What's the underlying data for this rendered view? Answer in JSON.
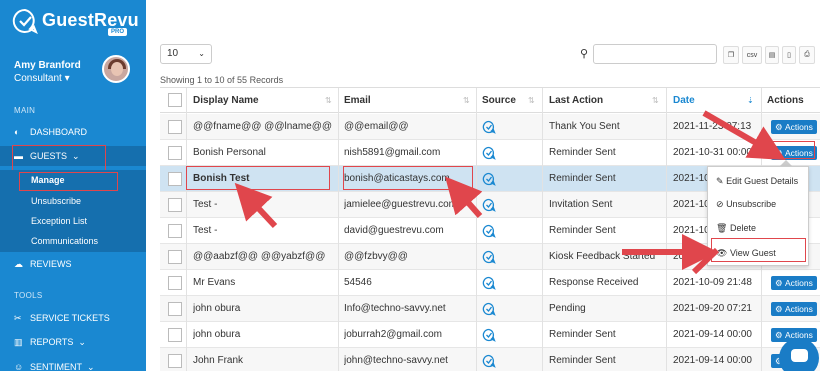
{
  "brand": {
    "name": "GuestRevu",
    "badge": "PRO"
  },
  "user": {
    "name": "Amy Branford",
    "role": "Consultant"
  },
  "sidebar": {
    "main_label": "MAIN",
    "tools_label": "TOOLS",
    "dashboard": "DASHBOARD",
    "guests": "GUESTS",
    "manage": "Manage",
    "unsubscribe": "Unsubscribe",
    "exception_list": "Exception List",
    "communications": "Communications",
    "reviews": "REVIEWS",
    "service_tickets": "SERVICE TICKETS",
    "reports": "REPORTS",
    "sentiment": "SENTIMENT"
  },
  "toolbar": {
    "page_size": "10",
    "csv": "csv"
  },
  "records_text": "Showing 1 to 10 of 55 Records",
  "table": {
    "headers": {
      "display_name": "Display Name",
      "email": "Email",
      "source": "Source",
      "last_action": "Last Action",
      "date": "Date",
      "actions": "Actions"
    },
    "action_label": "Actions",
    "rows": [
      {
        "name": "@@fname@@ @@lname@@",
        "email": "@@email@@",
        "last_action": "Thank You Sent",
        "date": "2021-11-23 07:13"
      },
      {
        "name": "Bonish Personal",
        "email": "nish5891@gmail.com",
        "last_action": "Reminder Sent",
        "date": "2021-10-31 00:00"
      },
      {
        "name": "Bonish Test",
        "email": "bonish@aticastays.com",
        "last_action": "Reminder Sent",
        "date": "2021-10"
      },
      {
        "name": "Test -",
        "email": "jamielee@guestrevu.com",
        "last_action": "Invitation Sent",
        "date": "2021-10"
      },
      {
        "name": "Test -",
        "email": "david@guestrevu.com",
        "last_action": "Reminder Sent",
        "date": "2021-10"
      },
      {
        "name": "@@aabzf@@ @@yabzf@@",
        "email": "@@fzbvy@@",
        "last_action": "Kiosk Feedback Started",
        "date": "2021-10"
      },
      {
        "name": "Mr Evans",
        "email": "54546",
        "last_action": "Response Received",
        "date": "2021-10-09 21:48"
      },
      {
        "name": "john obura",
        "email": "Info@techno-savvy.net",
        "last_action": "Pending",
        "date": "2021-09-20 07:21"
      },
      {
        "name": "john obura",
        "email": "joburrah2@gmail.com",
        "last_action": "Reminder Sent",
        "date": "2021-09-14 00:00"
      },
      {
        "name": "John Frank",
        "email": "john@techno-savvy.net",
        "last_action": "Reminder Sent",
        "date": "2021-09-14 00:00"
      }
    ]
  },
  "dropdown": {
    "edit": "Edit Guest Details",
    "unsubscribe": "Unsubscribe",
    "delete": "Delete",
    "view": "View Guest"
  },
  "colors": {
    "sidebar": "#1a88d1",
    "accent": "#1a7cc6",
    "highlight": "#e0464c",
    "selected_row": "#cfe3f2"
  }
}
